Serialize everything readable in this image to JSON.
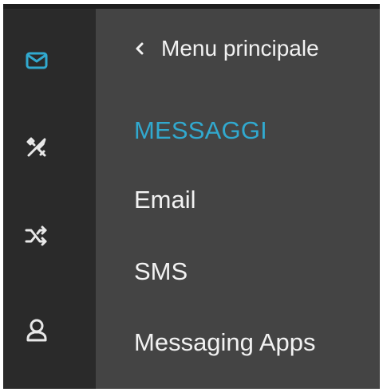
{
  "colors": {
    "background": "#444444",
    "rail": "#2a2a2a",
    "topbar": "#1e1e1e",
    "accent": "#31a9cf",
    "text": "#f2f2f2",
    "icon": "#e8e8e8"
  },
  "rail": {
    "items": [
      {
        "icon": "mail-icon",
        "active": true
      },
      {
        "icon": "tools-icon",
        "active": false
      },
      {
        "icon": "shuffle-icon",
        "active": false
      },
      {
        "icon": "user-icon",
        "active": false
      }
    ]
  },
  "panel": {
    "back_label": "Menu principale",
    "section_title": "MESSAGGI",
    "items": [
      {
        "label": "Email"
      },
      {
        "label": "SMS"
      },
      {
        "label": "Messaging Apps"
      }
    ]
  }
}
